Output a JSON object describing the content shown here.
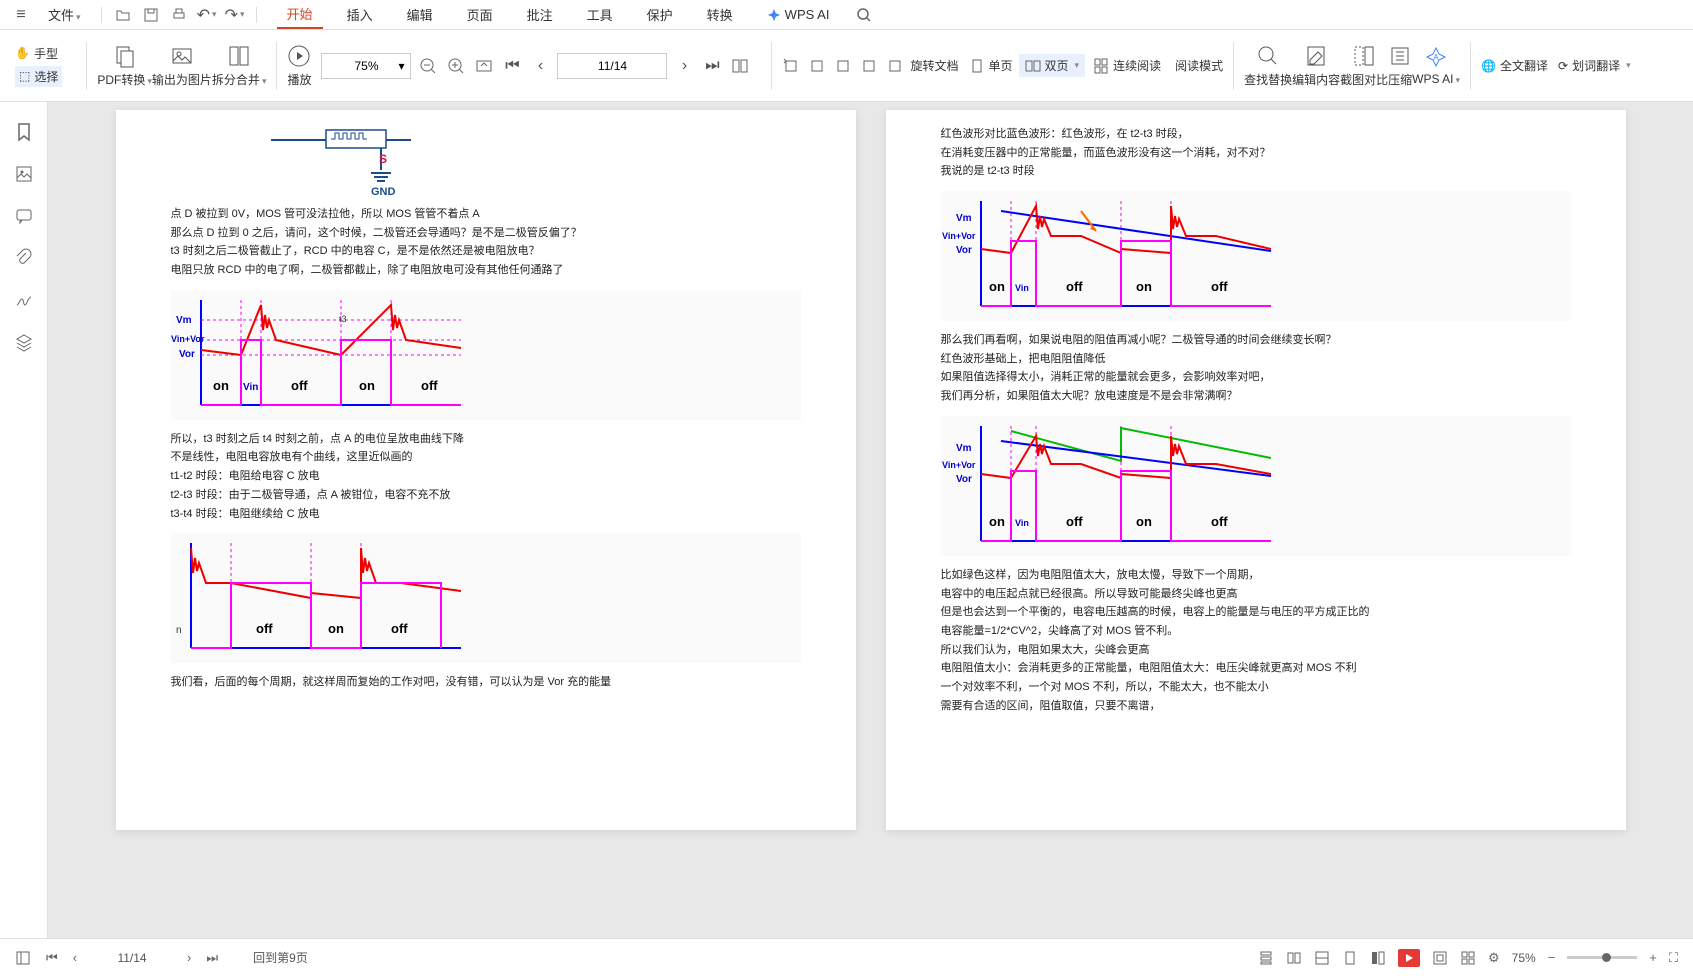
{
  "topMenu": {
    "file": "文件",
    "tabs": [
      "开始",
      "插入",
      "编辑",
      "页面",
      "批注",
      "工具",
      "保护",
      "转换"
    ],
    "activeTab": 0,
    "wpsAi": "WPS AI"
  },
  "toolbar": {
    "hand": "手型",
    "select": "选择",
    "pdfConvert": "PDF转换",
    "exportImage": "输出为图片",
    "splitMerge": "拆分合并",
    "play": "播放",
    "zoomValue": "75%",
    "pageValue": "11/14",
    "rotateDoc": "旋转文档",
    "singlePage": "单页",
    "doublePage": "双页",
    "contRead": "连续阅读",
    "readMode": "阅读模式",
    "findReplace": "查找替换",
    "editContent": "编辑内容",
    "screenCompare": "截图对比",
    "compress": "压缩",
    "wpsAi": "WPS AI",
    "fullTranslate": "全文翻译",
    "wordTranslate": "划词翻译"
  },
  "leftPage": {
    "circuitLabels": {
      "s": "S",
      "gnd": "GND"
    },
    "block1": [
      "点 D 被拉到 0V，MOS 管可没法拉他，所以 MOS 管管不着点 A",
      "那么点 D 拉到 0 之后，请问，这个时候，二极管还会导通吗？是不是二极管反偏了？",
      "t3 时刻之后二极管截止了，RCD 中的电容 C，是不是依然还是被电阻放电？",
      "电阻只放 RCD 中的电了啊，二极管都截止，除了电阻放电可没有其他任何通路了"
    ],
    "wave1Labels": {
      "vm": "Vm",
      "vinvor": "Vin+Vor",
      "vor": "Vor",
      "t3": "t3",
      "on": "on",
      "vin": "Vin",
      "off": "off",
      "on2": "on",
      "off2": "off"
    },
    "block2": [
      "所以，t3 时刻之后 t4 时刻之前，点 A 的电位呈放电曲线下降",
      "不是线性，电阻电容放电有个曲线，这里近似画的",
      "t1-t2 时段：电阻给电容 C 放电",
      "t2-t3 时段：由于二极管导通，点 A 被钳位，电容不充不放",
      "t3-t4 时段：电阻继续给 C 放电"
    ],
    "wave2Labels": {
      "n": "n",
      "off": "off",
      "on": "on",
      "off2": "off"
    },
    "block3": "我们看，后面的每个周期，就这样周而复始的工作对吧，没有错，可以认为是 Vor 充的能量"
  },
  "rightPage": {
    "block1": [
      "红色波形对比蓝色波形：红色波形，在 t2-t3 时段，",
      "在消耗变压器中的正常能量，而蓝色波形没有这一个消耗，对不对？",
      "我说的是 t2-t3 时段"
    ],
    "wave1Labels": {
      "vm": "Vm",
      "vinvor": "Vin+Vor",
      "vor": "Vor",
      "on": "on",
      "vin": "Vin",
      "off": "off",
      "on2": "on",
      "off2": "off"
    },
    "block2": [
      "那么我们再看啊，如果说电阻的阻值再减小呢？二极管导通的时间会继续变长啊？",
      "红色波形基础上，把电阻阻值降低",
      "如果阻值选择得太小，消耗正常的能量就会更多，会影响效率对吧，",
      "我们再分析，如果阻值太大呢？放电速度是不是会非常满啊？"
    ],
    "wave2Labels": {
      "vm": "Vm",
      "vinvor": "Vin+Vor",
      "vor": "Vor",
      "on": "on",
      "vin": "Vin",
      "off": "off",
      "on2": "on",
      "off2": "off"
    },
    "block3": [
      "比如绿色这样，因为电阻阻值太大，放电太慢，导致下一个周期，",
      "电容中的电压起点就已经很高。所以导致可能最终尖峰也更高",
      "但是也会达到一个平衡的，电容电压越高的时候，电容上的能量是与电压的平方成正比的",
      "电容能量=1/2*CV^2，尖峰高了对 MOS 管不利。",
      "所以我们认为，电阻如果太大，尖峰会更高",
      "电阻阻值太小：会消耗更多的正常能量，电阻阻值太大：电压尖峰就更高对 MOS 不利",
      "一个对效率不利，一个对 MOS 不利，所以，不能太大，也不能太小",
      "需要有合适的区间，阻值取值，只要不离谱，"
    ]
  },
  "statusBar": {
    "page": "11/14",
    "backTo": "回到第9页",
    "zoom": "75%"
  }
}
